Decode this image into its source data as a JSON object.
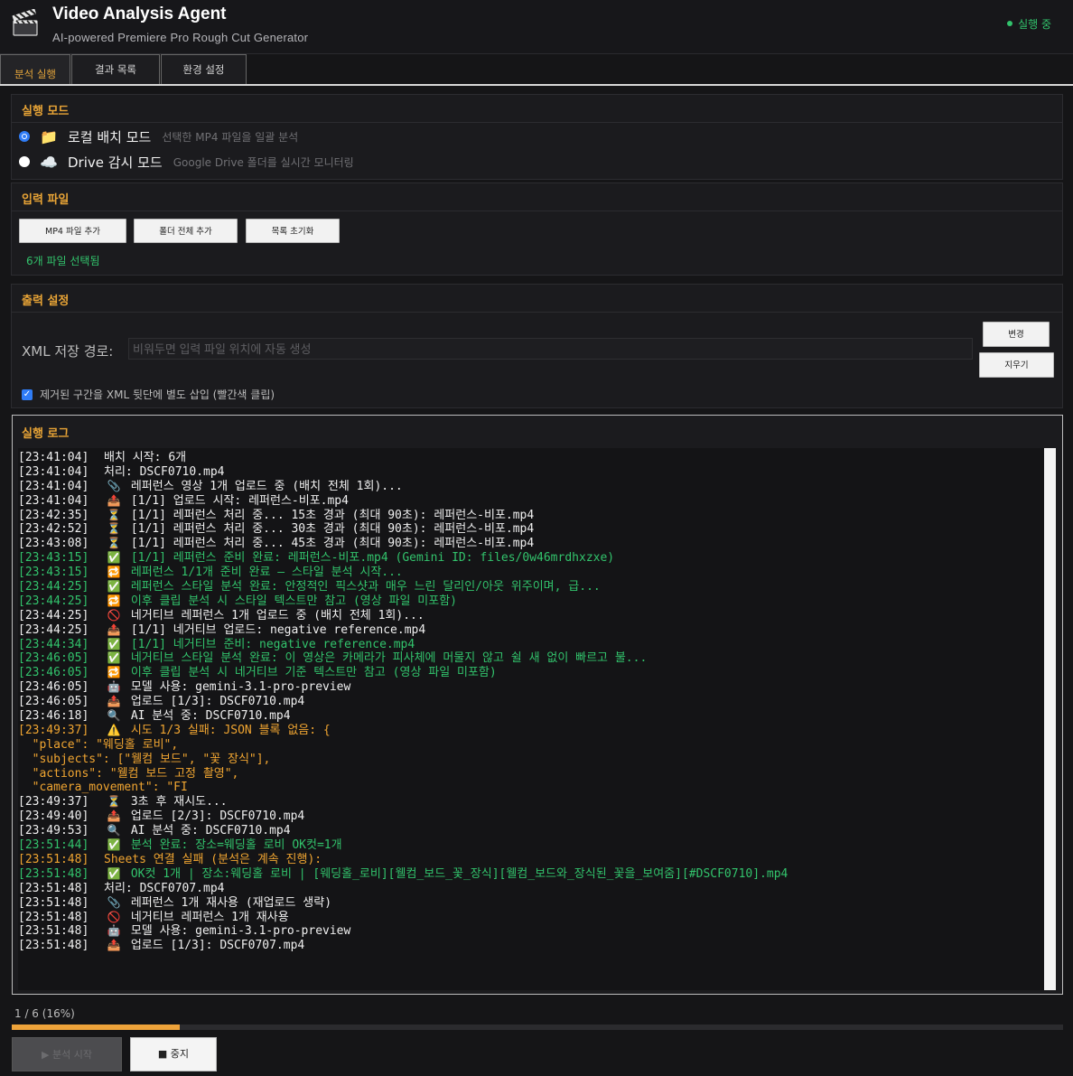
{
  "header": {
    "title": "Video Analysis Agent",
    "subtitle": "AI-powered Premiere Pro Rough Cut Generator",
    "status": "실행 중",
    "status_color": "#32c36c",
    "logo_icon": "clapperboard-icon"
  },
  "tabs": [
    {
      "label": "분석 실행",
      "active": true
    },
    {
      "label": "결과 목록",
      "active": false
    },
    {
      "label": "환경 설정",
      "active": false
    }
  ],
  "mode": {
    "title": "실행 모드",
    "options": [
      {
        "icon": "📁",
        "icon_name": "folder-icon",
        "label": "로컬 배치 모드",
        "desc": "선택한 MP4 파일을 일괄 분석",
        "selected": true
      },
      {
        "icon": "☁️",
        "icon_name": "cloud-icon",
        "label": "Drive 감시 모드",
        "desc": "Google Drive 폴더를 실시간 모니터링",
        "selected": false
      }
    ]
  },
  "input": {
    "title": "입력 파일",
    "add_mp4": "MP4 파일 추가",
    "add_folder": "폴더 전체 추가",
    "clear_list": "목록 초기화",
    "count_text": "6개 파일 선택됨"
  },
  "output": {
    "title": "출력 설정",
    "xml_label": "XML 저장 경로:",
    "xml_value": "",
    "xml_placeholder": "비워두면 입력 파일 위치에 자동 생성",
    "change_btn": "변경",
    "clear_btn": "지우기",
    "insert_removed_label": "제거된 구간을 XML 뒷단에 별도 삽입 (빨간색 클립)",
    "insert_removed_checked": true
  },
  "log": {
    "title": "실행 로그",
    "lines": [
      {
        "ts": "[23:41:04]",
        "icon": "",
        "text": "배치 시작: 6개",
        "color": "w"
      },
      {
        "ts": "[23:41:04]",
        "icon": "",
        "text": "처리: DSCF0710.mp4",
        "color": "w"
      },
      {
        "ts": "[23:41:04]",
        "icon": "📎",
        "text": "레퍼런스 영상 1개 업로드 중 (배치 전체 1회)...",
        "color": "w"
      },
      {
        "ts": "[23:41:04]",
        "icon": "📤",
        "text": "[1/1] 업로드 시작: 레퍼런스-비포.mp4",
        "color": "w"
      },
      {
        "ts": "[23:42:35]",
        "icon": "⏳",
        "text": "[1/1] 레퍼런스 처리 중... 15초 경과 (최대 90초): 레퍼런스-비포.mp4",
        "color": "w"
      },
      {
        "ts": "[23:42:52]",
        "icon": "⏳",
        "text": "[1/1] 레퍼런스 처리 중... 30초 경과 (최대 90초): 레퍼런스-비포.mp4",
        "color": "w"
      },
      {
        "ts": "[23:43:08]",
        "icon": "⏳",
        "text": "[1/1] 레퍼런스 처리 중... 45초 경과 (최대 90초): 레퍼런스-비포.mp4",
        "color": "w"
      },
      {
        "ts": "[23:43:15]",
        "icon": "✅",
        "text": "[1/1] 레퍼런스 준비 완료: 레퍼런스-비포.mp4 (Gemini ID: files/0w46mrdhxzxe)",
        "color": "g"
      },
      {
        "ts": "[23:43:15]",
        "icon": "🔁",
        "text": "레퍼런스 1/1개 준비 완료 — 스타일 분석 시작...",
        "color": "g"
      },
      {
        "ts": "[23:44:25]",
        "icon": "✅",
        "text": "레퍼런스 스타일 분석 완료: 안정적인 픽스샷과 매우 느린 달리인/아웃 위주이며, 급...",
        "color": "g"
      },
      {
        "ts": "[23:44:25]",
        "icon": "🔁",
        "text": "이후 클립 분석 시 스타일 텍스트만 참고 (영상 파일 미포함)",
        "color": "g"
      },
      {
        "ts": "[23:44:25]",
        "icon": "🚫",
        "text": "네거티브 레퍼런스 1개 업로드 중 (배치 전체 1회)...",
        "color": "w"
      },
      {
        "ts": "[23:44:25]",
        "icon": "📤",
        "text": "[1/1] 네거티브 업로드: negative reference.mp4",
        "color": "w"
      },
      {
        "ts": "[23:44:34]",
        "icon": "✅",
        "text": "[1/1] 네거티브 준비: negative reference.mp4",
        "color": "g"
      },
      {
        "ts": "[23:46:05]",
        "icon": "✅",
        "text": "네거티브 스타일 분석 완료: 이 영상은 카메라가 피사체에 머물지 않고 쉴 새 없이 빠르고 불...",
        "color": "g"
      },
      {
        "ts": "[23:46:05]",
        "icon": "🔁",
        "text": "이후 클립 분석 시 네거티브 기준 텍스트만 참고 (영상 파일 미포함)",
        "color": "g"
      },
      {
        "ts": "[23:46:05]",
        "icon": "🤖",
        "text": "모델 사용: gemini-3.1-pro-preview",
        "color": "w"
      },
      {
        "ts": "[23:46:05]",
        "icon": "📤",
        "text": "업로드 [1/3]: DSCF0710.mp4",
        "color": "w"
      },
      {
        "ts": "[23:46:18]",
        "icon": "🔍",
        "text": "AI 분석 중: DSCF0710.mp4",
        "color": "w"
      },
      {
        "ts": "[23:49:37]",
        "icon": "⚠️",
        "text": "시도 1/3 실패: JSON 블록 없음: {",
        "color": "o"
      },
      {
        "ts": "",
        "icon": "",
        "text": "  \"place\": \"웨딩홀 로비\",",
        "color": "o"
      },
      {
        "ts": "",
        "icon": "",
        "text": "  \"subjects\": [\"웰컴 보드\", \"꽃 장식\"],",
        "color": "o"
      },
      {
        "ts": "",
        "icon": "",
        "text": "  \"actions\": \"웰컴 보드 고정 촬영\",",
        "color": "o"
      },
      {
        "ts": "",
        "icon": "",
        "text": "  \"camera_movement\": \"FI",
        "color": "o"
      },
      {
        "ts": "[23:49:37]",
        "icon": "⏳",
        "text": "3초 후 재시도...",
        "color": "w"
      },
      {
        "ts": "[23:49:40]",
        "icon": "📤",
        "text": "업로드 [2/3]: DSCF0710.mp4",
        "color": "w"
      },
      {
        "ts": "[23:49:53]",
        "icon": "🔍",
        "text": "AI 분석 중: DSCF0710.mp4",
        "color": "w"
      },
      {
        "ts": "[23:51:44]",
        "icon": "✅",
        "text": "분석 완료: 장소=웨딩홀 로비 OK컷=1개",
        "color": "g"
      },
      {
        "ts": "[23:51:48]",
        "icon": "",
        "text": "Sheets 연결 실패 (분석은 계속 진행):",
        "color": "o"
      },
      {
        "ts": "[23:51:48]",
        "icon": "✅",
        "text": "OK컷 1개 | 장소:웨딩홀 로비 | [웨딩홀_로비][웰컴_보드_꽃_장식][웰컴_보드와_장식된_꽃을_보여줌][#DSCF0710].mp4",
        "color": "g"
      },
      {
        "ts": "[23:51:48]",
        "icon": "",
        "text": "처리: DSCF0707.mp4",
        "color": "w"
      },
      {
        "ts": "[23:51:48]",
        "icon": "📎",
        "text": "레퍼런스 1개 재사용 (재업로드 생략)",
        "color": "w"
      },
      {
        "ts": "[23:51:48]",
        "icon": "🚫",
        "text": "네거티브 레퍼런스 1개 재사용",
        "color": "w"
      },
      {
        "ts": "[23:51:48]",
        "icon": "🤖",
        "text": "모델 사용: gemini-3.1-pro-preview",
        "color": "w"
      },
      {
        "ts": "[23:51:48]",
        "icon": "📤",
        "text": "업로드 [1/3]: DSCF0707.mp4",
        "color": "w"
      }
    ]
  },
  "progress": {
    "text": "1 / 6  (16%)",
    "fraction": 0.16,
    "color": "#eea33a"
  },
  "actions": {
    "start_label": "▶ 분석 시작",
    "start_enabled": false,
    "stop_label": "■ 중지"
  }
}
